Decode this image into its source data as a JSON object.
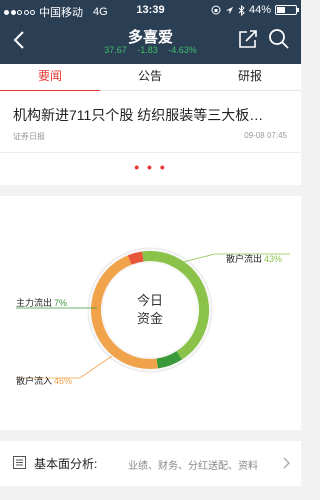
{
  "status_bar": {
    "carrier": "中国移动",
    "network": "4G",
    "time": "13:39",
    "battery": "44%",
    "battery_level": 0.44
  },
  "header": {
    "title": "多喜爱",
    "quote": {
      "price": "37.67",
      "change": "-1.83",
      "change_pct": "-4.63%"
    },
    "quote_color": "#3fbf6a",
    "bg_color": "#2a3e54"
  },
  "tabs": [
    {
      "label": "要闻",
      "active": true
    },
    {
      "label": "公告",
      "active": false
    },
    {
      "label": "研报",
      "active": false
    }
  ],
  "news": {
    "title": "机构新进711只个股 纺织服装等三大板…",
    "source": "证券日报",
    "time": "09-08 07:45",
    "more": "• • •"
  },
  "funds": {
    "center_label": [
      "今日",
      "资金"
    ],
    "labels": {
      "retail_out": {
        "name": "散户流出",
        "pct": "43%"
      },
      "main_out": {
        "name": "主力流出",
        "pct": "7%"
      },
      "retail_in": {
        "name": "散户流入",
        "pct": "46%"
      }
    },
    "colors": {
      "retail_out": "#8bc34a",
      "main_out": "#3a9a3a",
      "retail_in": "#f0a34a",
      "main_in": "#e8553a"
    }
  },
  "chart_data": {
    "type": "pie",
    "series": [
      {
        "name": "散户流出",
        "value": 43
      },
      {
        "name": "主力流出",
        "value": 7
      },
      {
        "name": "散户流入",
        "value": 46
      },
      {
        "name": "",
        "value": 4
      }
    ]
  },
  "fundamentals": {
    "title": "基本面分析:",
    "items": "业绩、财务、分红送配、资料"
  }
}
